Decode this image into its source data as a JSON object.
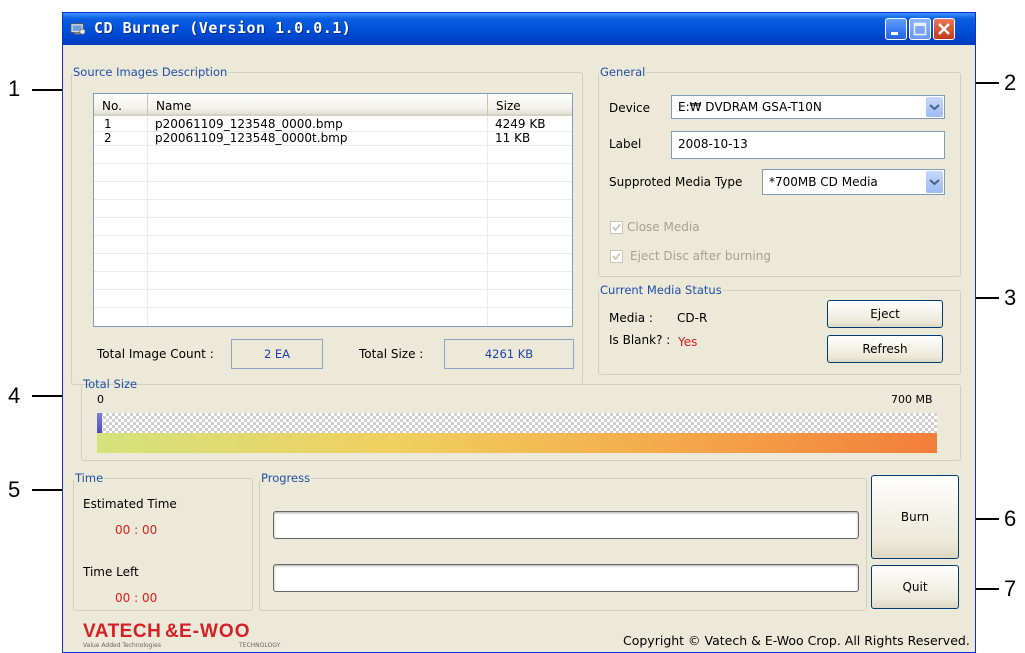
{
  "window": {
    "title": "CD Burner (Version 1.0.0.1)"
  },
  "source": {
    "legend": "Source Images Description",
    "columns": [
      "No.",
      "Name",
      "Size"
    ],
    "rows": [
      {
        "no": "1",
        "name": "p20061109_123548_0000.bmp",
        "size": "4249 KB"
      },
      {
        "no": "2",
        "name": "p20061109_123548_0000t.bmp",
        "size": "11 KB"
      }
    ],
    "total_count_label": "Total Image Count :",
    "total_count_value": "2 EA",
    "total_size_label": "Total Size :",
    "total_size_value": "4261 KB"
  },
  "general": {
    "legend": "General",
    "device_label": "Device",
    "device_value": "E:₩ DVDRAM GSA-T10N",
    "label_label": "Label",
    "label_value": "2008-10-13",
    "media_type_label": "Supproted Media Type",
    "media_type_value": "*700MB CD Media",
    "close_media": "Close Media",
    "eject_after": "Eject Disc after burning"
  },
  "media_status": {
    "legend": "Current Media Status",
    "media_label": "Media :",
    "media_value": "CD-R",
    "blank_label": "Is Blank? :",
    "blank_value": "Yes",
    "eject": "Eject",
    "refresh": "Refresh"
  },
  "total_size": {
    "legend": "Total Size",
    "min_label": "0",
    "max_label": "700 MB",
    "used_fraction": 0.006
  },
  "time": {
    "legend": "Time",
    "estimated_label": "Estimated  Time",
    "estimated_value": "00 : 00",
    "left_label": "Time Left",
    "left_value": "00 : 00"
  },
  "progress": {
    "legend": "Progress"
  },
  "actions": {
    "burn": "Burn",
    "quit": "Quit"
  },
  "footer": {
    "logo_text_1": "VATECH",
    "logo_amp": "&",
    "logo_text_2": "E-WOO",
    "logo_sub_1": "Value Added Technologies",
    "logo_sub_2": "TECHNOLOGY",
    "copyright": "Copyright © Vatech & E-Woo Crop. All Rights Reserved."
  },
  "annotations": [
    "1",
    "2",
    "3",
    "4",
    "5",
    "6",
    "7"
  ],
  "colors": {
    "title_bar": "#0050d8",
    "legend_blue": "#1f4fa8",
    "value_red": "#d42020",
    "logo_red": "#d61f26"
  }
}
